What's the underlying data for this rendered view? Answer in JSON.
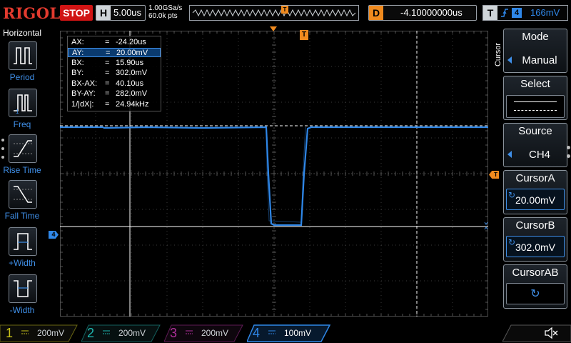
{
  "topbar": {
    "brand": "RIGOL",
    "run_state": "STOP",
    "timebase": {
      "label": "H",
      "value": "5.00us"
    },
    "sample_rate": "1.00GSa/s",
    "memory_depth": "60.0k pts",
    "trigger_pos_label": "T",
    "delay": {
      "label": "D",
      "value": "-4.10000000us"
    },
    "trigger": {
      "label": "T",
      "source": "4",
      "level": "166mV"
    }
  },
  "horizontal_menu": {
    "title": "Horizontal",
    "items": [
      {
        "label": "Period",
        "icon": "period-icon"
      },
      {
        "label": "Freq",
        "icon": "frequency-icon"
      },
      {
        "label": "Rise Time",
        "icon": "rise-time-icon"
      },
      {
        "label": "Fall Time",
        "icon": "fall-time-icon"
      },
      {
        "label": "+Width",
        "icon": "positive-width-icon"
      },
      {
        "label": "-Width",
        "icon": "negative-width-icon"
      }
    ]
  },
  "cursor_readout": {
    "rows": [
      {
        "key": "AX:",
        "eq": "=",
        "value": "-24.20us",
        "selected": false
      },
      {
        "key": "AY:",
        "eq": "=",
        "value": "20.00mV",
        "selected": true
      },
      {
        "key": "BX:",
        "eq": "=",
        "value": "15.90us",
        "selected": false
      },
      {
        "key": "BY:",
        "eq": "=",
        "value": "302.0mV",
        "selected": false
      },
      {
        "key": "BX-AX:",
        "eq": "=",
        "value": "40.10us",
        "selected": false
      },
      {
        "key": "BY-AY:",
        "eq": "=",
        "value": "282.0mV",
        "selected": false
      },
      {
        "key": "1/|dX|:",
        "eq": "=",
        "value": "24.94kHz",
        "selected": false
      }
    ]
  },
  "markers": {
    "channel4": "4",
    "trigger_level": "T",
    "trigger_position": "T"
  },
  "waveform": {
    "channel": "4",
    "high_level_mV": 302.0,
    "low_level_mV": 20.0,
    "pulse_start_us": -4.2,
    "pulse_end_us": -1.6,
    "color": "#2f87e8"
  },
  "cursor_menu": {
    "vertical_title": "Cursor",
    "mode": {
      "title": "Mode",
      "value": "Manual"
    },
    "select": {
      "title": "Select"
    },
    "source": {
      "title": "Source",
      "value": "CH4"
    },
    "cursor_a": {
      "title": "CursorA",
      "value": "20.00mV"
    },
    "cursor_b": {
      "title": "CursorB",
      "value": "302.0mV"
    },
    "cursor_ab": {
      "title": "CursorAB"
    }
  },
  "channels": [
    {
      "num": "1",
      "scale": "200mV",
      "color": "#c9c21a",
      "active": false
    },
    {
      "num": "2",
      "scale": "200mV",
      "color": "#1fb6b0",
      "active": false
    },
    {
      "num": "3",
      "scale": "200mV",
      "color": "#b0309b",
      "active": false
    },
    {
      "num": "4",
      "scale": "100mV",
      "color": "#2f87e8",
      "active": true
    }
  ],
  "colors": {
    "ch4": "#2f87e8",
    "trigger": "#f08a1e",
    "stop": "#d11414",
    "brand": "#e23a2e"
  }
}
